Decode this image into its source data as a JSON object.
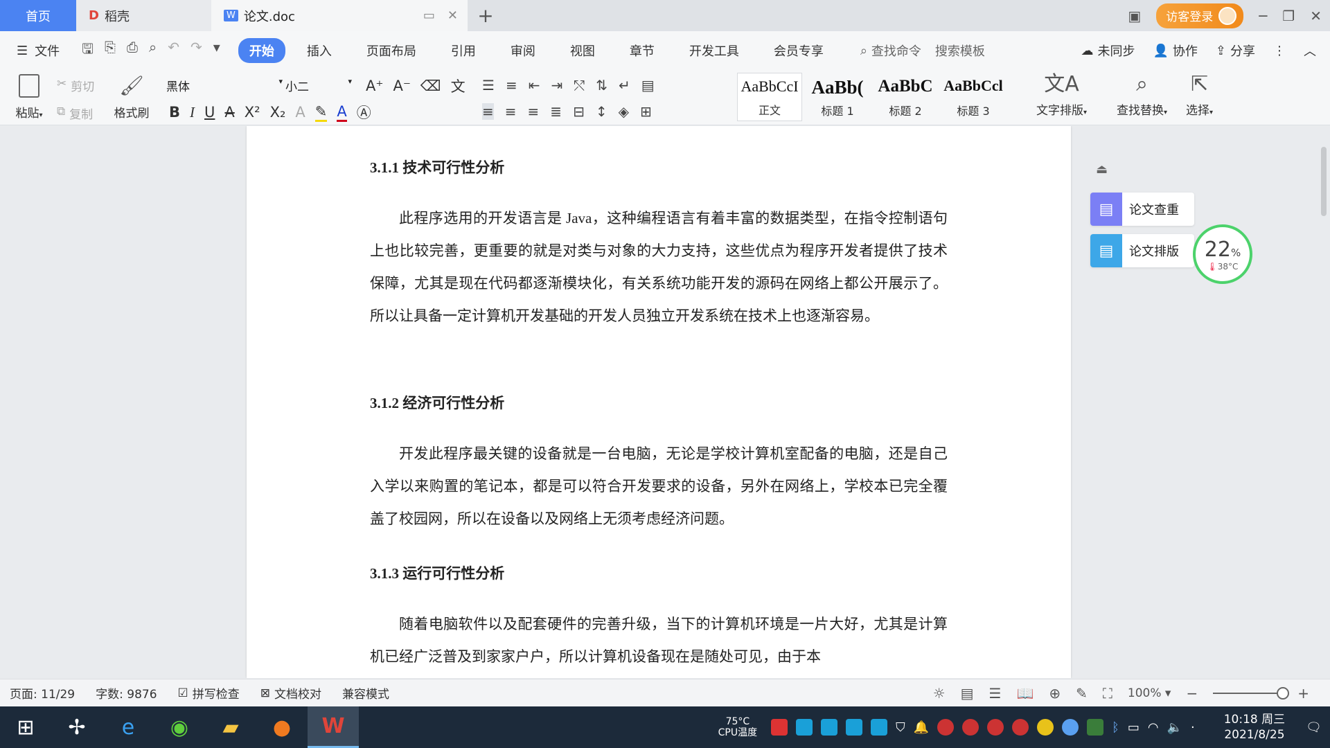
{
  "tabs": {
    "home": "首页",
    "daoke": "稻壳",
    "doc": "论文.doc",
    "new_tab": "+"
  },
  "titlebar": {
    "login": "访客登录"
  },
  "menu": {
    "file": "文件",
    "tabs": [
      "开始",
      "插入",
      "页面布局",
      "引用",
      "审阅",
      "视图",
      "章节",
      "开发工具",
      "会员专享"
    ],
    "search_cmd": "查找命令",
    "search_template": "搜索模板",
    "sync": "未同步",
    "collab": "协作",
    "share": "分享"
  },
  "ribbon": {
    "paste": "粘贴",
    "cut": "剪切",
    "copy": "复制",
    "format_painter": "格式刷",
    "font": "黑体",
    "size": "小二",
    "styles": [
      {
        "sample": "AaBbCcI",
        "label": "正文"
      },
      {
        "sample": "AaBb(",
        "label": "标题 1"
      },
      {
        "sample": "AaBbC",
        "label": "标题 2"
      },
      {
        "sample": "AaBbCcl",
        "label": "标题 3"
      }
    ],
    "text_layout": "文字排版",
    "find_replace": "查找替换",
    "select": "选择"
  },
  "document": {
    "h1": "3.1.1  技术可行性分析",
    "p1": "此程序选用的开发语言是 Java，这种编程语言有着丰富的数据类型，在指令控制语句上也比较完善，更重要的就是对类与对象的大力支持，这些优点为程序开发者提供了技术保障，尤其是现在代码都逐渐模块化，有关系统功能开发的源码在网络上都公开展示了。所以让具备一定计算机开发基础的开发人员独立开发系统在技术上也逐渐容易。",
    "h2": "3.1.2  经济可行性分析",
    "p2": "开发此程序最关键的设备就是一台电脑，无论是学校计算机室配备的电脑，还是自己入学以来购置的笔记本，都是可以符合开发要求的设备，另外在网络上，学校本已完全覆盖了校园网，所以在设备以及网络上无须考虑经济问题。",
    "h3": "3.1.3  运行可行性分析",
    "p3": "随着电脑软件以及配套硬件的完善升级，当下的计算机环境是一片大好，尤其是计算机已经广泛普及到家家户户，所以计算机设备现在是随处可见，由于本"
  },
  "sidepanel": {
    "check": "论文查重",
    "format": "论文排版",
    "cpu_pct": "22",
    "cpu_unit": "%",
    "cpu_temp": "38°C"
  },
  "statusbar": {
    "page": "页面: 11/29",
    "words": "字数: 9876",
    "spell": "拼写检查",
    "proof": "文档校对",
    "compat": "兼容模式",
    "zoom": "100%"
  },
  "taskbar": {
    "cpu_temp": "75°C",
    "cpu_label": "CPU温度",
    "time": "10:18 周三",
    "date": "2021/8/25"
  },
  "colors": {
    "accent": "#4b83f2",
    "login": "#f18a1b",
    "gauge": "#4cd26b"
  }
}
